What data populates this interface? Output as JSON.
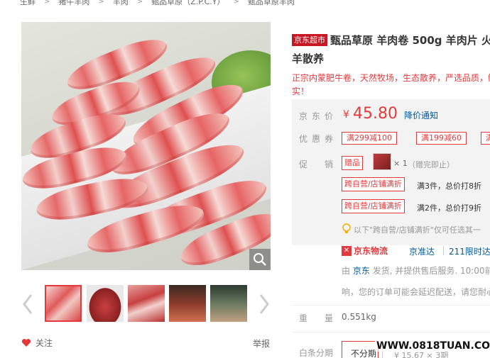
{
  "breadcrumb": [
    "生鲜",
    "猪牛羊肉",
    "羊肉",
    "甄品草原（Z.P.C.Y）",
    "甄品草原羊肉"
  ],
  "product": {
    "store_tag": "京东超市",
    "title_line1": "甄品草原 羊肉卷 500g 羊肉片 火",
    "title_line2": "羊散养",
    "subtitle_line1": "正宗内蒙肥牛卷，天然牧场，生态散养，严选品质，鲜",
    "subtitle_line2": "实！"
  },
  "summary": {
    "price_label": "京东价",
    "price_symbol": "¥",
    "price": "45.80",
    "notify": "降价通知",
    "coupon_label": "优惠券",
    "coupons": [
      "满299减100",
      "满199减60",
      "满"
    ],
    "promo_label": "促　销",
    "gift_tag": "赠品",
    "gift_count": "× 1",
    "gift_note": "（赠完即止）",
    "promo1_tag": "跨自营/店铺满折",
    "promo1_text": "满3件，总价打8折",
    "promo2_tag": "跨自营/店铺满折",
    "promo2_text": "满2件，总价打9折",
    "tip": "以下\"跨自营/店铺满折\"仅可任选其一"
  },
  "shipping": {
    "logo": "京东物流",
    "service_a": "京准达",
    "service_b": "211限时达",
    "seller_prefix": "由",
    "seller": "京东",
    "seller_suffix": "发货, 并提供售后服务. 10:00前",
    "delay": "响，您的订单可能会延迟配送，请您耐心"
  },
  "weight_label": "重　量",
  "weight": "0.551kg",
  "baitiao_label": "白条分期",
  "baitiao_opt1": "不分期",
  "baitiao_opt2": "¥ 15.67 × 3期",
  "follow": "关注",
  "report": "举报",
  "watermark": "WWW.0818TUAN.COM",
  "colors": {
    "accent": "#e4393c",
    "link": "#005aa0",
    "summary_bg": "#f3f3f3"
  }
}
